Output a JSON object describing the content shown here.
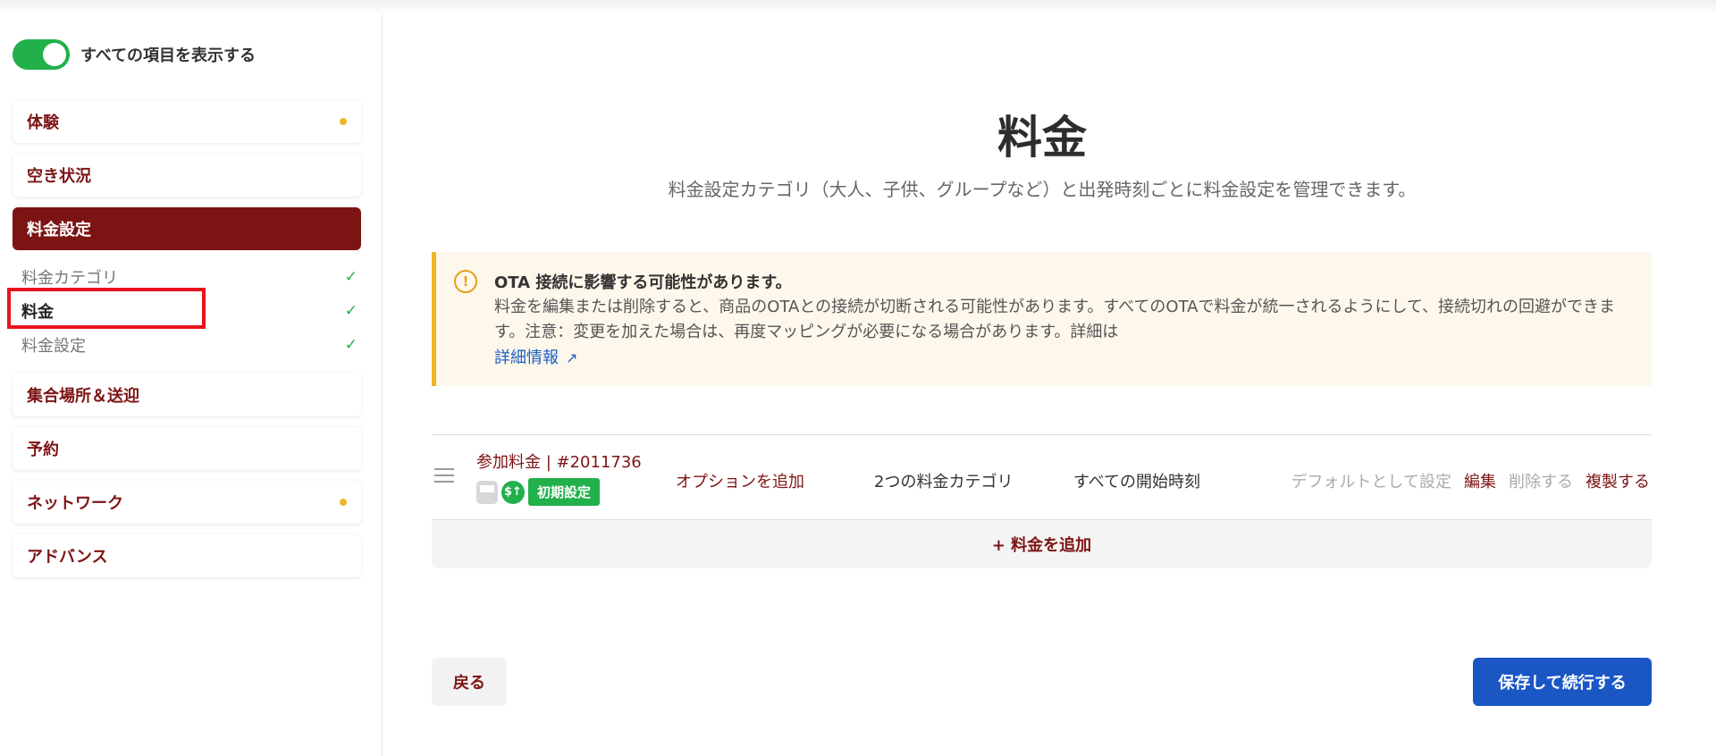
{
  "sidebar": {
    "toggle_label": "すべての項目を表示する",
    "items": [
      {
        "label": "体験",
        "dot": true
      },
      {
        "label": "空き状況"
      },
      {
        "label": "料金設定",
        "active": true
      },
      {
        "label": "集合場所＆送迎"
      },
      {
        "label": "予約"
      },
      {
        "label": "ネットワーク",
        "dot": true
      },
      {
        "label": "アドバンス"
      }
    ],
    "sub_items": [
      {
        "label": "料金カテゴリ",
        "check": "✓"
      },
      {
        "label": "料金",
        "check": "✓",
        "current": true
      },
      {
        "label": "料金設定",
        "check": "✓"
      }
    ]
  },
  "main": {
    "title": "料金",
    "subtitle": "料金設定カテゴリ（大人、子供、グループなど）と出発時刻ごとに料金設定を管理できます。",
    "alert": {
      "title": "OTA 接続に影響する可能性があります。",
      "body": "料金を編集または削除すると、商品のOTAとの接続が切断される可能性があります。すべてのOTAで料金が統一されるようにして、接続切れの回避ができます。注意：変更を加えた場合は、再度マッピングが必要になる場合があります。詳細は",
      "link": "詳細情報"
    },
    "pricing_row": {
      "name": "参加料金 | #2011736",
      "badge": "初期設定",
      "add_option": "オプションを追加",
      "categories": "2つの料金カテゴリ",
      "start_times": "すべての開始時刻",
      "actions": {
        "set_default": "デフォルトとして設定",
        "edit": "編集",
        "delete": "削除する",
        "duplicate": "複製する"
      }
    },
    "add_price": "+ 料金を追加",
    "back": "戻る",
    "save": "保存して続行する"
  },
  "colors": {
    "brand": "#7d1414",
    "success": "#22b04b",
    "warning": "#f0b429",
    "primary_button": "#1a56c4",
    "highlight": "#e8131b"
  }
}
